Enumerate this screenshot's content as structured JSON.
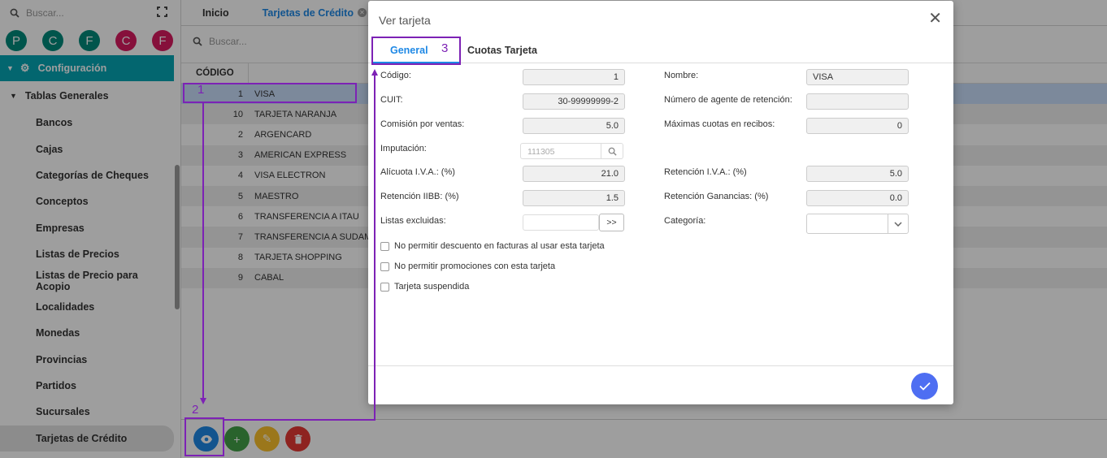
{
  "sidebar": {
    "search_placeholder": "Buscar...",
    "avatars": [
      {
        "letter": "P",
        "color": "#00897b"
      },
      {
        "letter": "C",
        "color": "#00897b"
      },
      {
        "letter": "F",
        "color": "#00897b"
      },
      {
        "letter": "C",
        "color": "#d81b60"
      },
      {
        "letter": "F",
        "color": "#d81b60"
      }
    ],
    "config_label": "Configuración",
    "config_color": "#05a5b4",
    "group_label": "Tablas Generales",
    "items": [
      {
        "label": "Bancos"
      },
      {
        "label": "Cajas"
      },
      {
        "label": "Categorías de Cheques"
      },
      {
        "label": "Conceptos"
      },
      {
        "label": "Empresas"
      },
      {
        "label": "Listas de Precios"
      },
      {
        "label": "Listas de Precio para Acopio"
      },
      {
        "label": "Localidades"
      },
      {
        "label": "Monedas"
      },
      {
        "label": "Provincias"
      },
      {
        "label": "Partidos"
      },
      {
        "label": "Sucursales"
      },
      {
        "label": "Tarjetas de Crédito"
      }
    ]
  },
  "tabs": {
    "home": "Inicio",
    "cards": "Tarjetas de Crédito",
    "active_color": "#1e88e5"
  },
  "grid": {
    "search_placeholder": "Buscar...",
    "code_header": "CÓDIGO",
    "rows": [
      {
        "code": "1",
        "name": "VISA"
      },
      {
        "code": "10",
        "name": "TARJETA NARANJA"
      },
      {
        "code": "2",
        "name": "ARGENCARD"
      },
      {
        "code": "3",
        "name": "AMERICAN EXPRESS"
      },
      {
        "code": "4",
        "name": "VISA ELECTRON"
      },
      {
        "code": "5",
        "name": "MAESTRO"
      },
      {
        "code": "6",
        "name": "TRANSFERENCIA A ITAU"
      },
      {
        "code": "7",
        "name": "TRANSFERENCIA A SUDAME"
      },
      {
        "code": "8",
        "name": "TARJETA SHOPPING"
      },
      {
        "code": "9",
        "name": "CABAL"
      }
    ],
    "selected_row_color": "#c9ddfb"
  },
  "toolbar": {
    "view_color": "#1e88e5",
    "add_color": "#43a047",
    "edit_color": "#fbc02d",
    "delete_color": "#e53935"
  },
  "modal": {
    "title": "Ver tarjeta",
    "tab_general": "General",
    "tab_cuotas": "Cuotas Tarjeta",
    "fields": {
      "codigo_label": "Código:",
      "codigo_value": "1",
      "nombre_label": "Nombre:",
      "nombre_value": "VISA",
      "cuit_label": "CUIT:",
      "cuit_value": "30-99999999-2",
      "agente_label": "Número de agente de retención:",
      "agente_value": "",
      "comision_label": "Comisión por ventas:",
      "comision_value": "5.0",
      "cuotas_label": "Máximas cuotas en recibos:",
      "cuotas_value": "0",
      "imputacion_label": "Imputación:",
      "imputacion_value": "111305",
      "alicuota_label": "Alícuota I.V.A.: (%)",
      "alicuota_value": "21.0",
      "ret_iva_label": "Retención I.V.A.: (%)",
      "ret_iva_value": "5.0",
      "ret_iibb_label": "Retención IIBB: (%)",
      "ret_iibb_value": "1.5",
      "ret_gan_label": "Retención Ganancias: (%)",
      "ret_gan_value": "0.0",
      "listas_label": "Listas excluidas:",
      "listas_btn": ">>",
      "categoria_label": "Categoría:"
    },
    "checkboxes": [
      {
        "label": "No permitir descuento en facturas al usar esta tarjeta"
      },
      {
        "label": "No permitir promociones con esta tarjeta"
      },
      {
        "label": "Tarjeta suspendida"
      }
    ],
    "confirm_color": "#4e6ef2"
  },
  "annotations": {
    "color": "#7d22b5",
    "step1": "1",
    "step2": "2",
    "step3": "3"
  }
}
